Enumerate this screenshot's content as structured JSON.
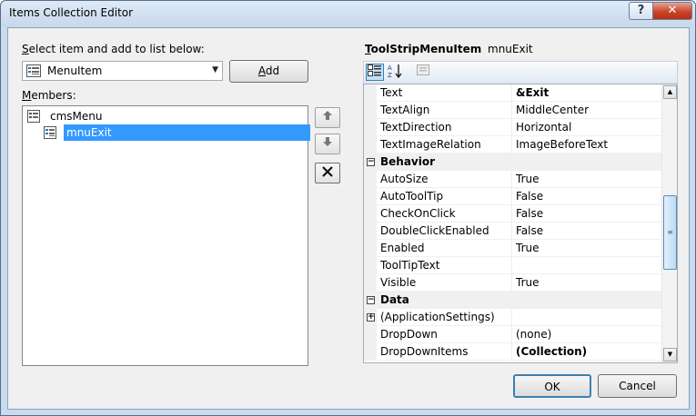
{
  "window": {
    "title": "Items Collection Editor",
    "help_label": "?",
    "close_label": "✕"
  },
  "left": {
    "select_label_prefix": "S",
    "select_label_rest": "elect item and add to list below:",
    "item_type_value": "MenuItem",
    "add_label_prefix": "A",
    "add_label_rest": "dd",
    "members_label_prefix": "M",
    "members_label_rest": "embers:",
    "tree": [
      {
        "label": "cmsMenu",
        "selected": false
      },
      {
        "label": "mnuExit",
        "selected": true
      }
    ],
    "move_up_icon": "arrow-up-icon",
    "move_down_icon": "arrow-down-icon",
    "delete_icon": "delete-x-icon"
  },
  "properties": {
    "object_type_prefix": "T",
    "object_type_rest": "oolStripMenuItem",
    "object_name": "mnuExit",
    "toolbar": [
      {
        "name": "categorized-icon",
        "active": true
      },
      {
        "name": "alphabetical-icon",
        "active": false
      },
      {
        "name": "property-pages-icon",
        "active": false
      }
    ],
    "rows": [
      {
        "kind": "prop",
        "name": "Text",
        "value": "&Exit",
        "bold": true
      },
      {
        "kind": "prop",
        "name": "TextAlign",
        "value": "MiddleCenter",
        "bold": false
      },
      {
        "kind": "prop",
        "name": "TextDirection",
        "value": "Horizontal",
        "bold": false
      },
      {
        "kind": "prop",
        "name": "TextImageRelation",
        "value": "ImageBeforeText",
        "bold": false
      },
      {
        "kind": "cat",
        "name": "Behavior",
        "expander": "−"
      },
      {
        "kind": "prop",
        "name": "AutoSize",
        "value": "True",
        "bold": false
      },
      {
        "kind": "prop",
        "name": "AutoToolTip",
        "value": "False",
        "bold": false
      },
      {
        "kind": "prop",
        "name": "CheckOnClick",
        "value": "False",
        "bold": false
      },
      {
        "kind": "prop",
        "name": "DoubleClickEnabled",
        "value": "False",
        "bold": false
      },
      {
        "kind": "prop",
        "name": "Enabled",
        "value": "True",
        "bold": false
      },
      {
        "kind": "prop",
        "name": "ToolTipText",
        "value": "",
        "bold": false
      },
      {
        "kind": "prop",
        "name": "Visible",
        "value": "True",
        "bold": false
      },
      {
        "kind": "cat",
        "name": "Data",
        "expander": "−"
      },
      {
        "kind": "prop",
        "name": "(ApplicationSettings)",
        "value": "",
        "bold": false,
        "expander": "+"
      },
      {
        "kind": "prop",
        "name": "DropDown",
        "value": "(none)",
        "bold": false
      },
      {
        "kind": "prop",
        "name": "DropDownItems",
        "value": "(Collection)",
        "bold": true
      }
    ]
  },
  "buttons": {
    "ok": "OK",
    "cancel": "Cancel"
  }
}
